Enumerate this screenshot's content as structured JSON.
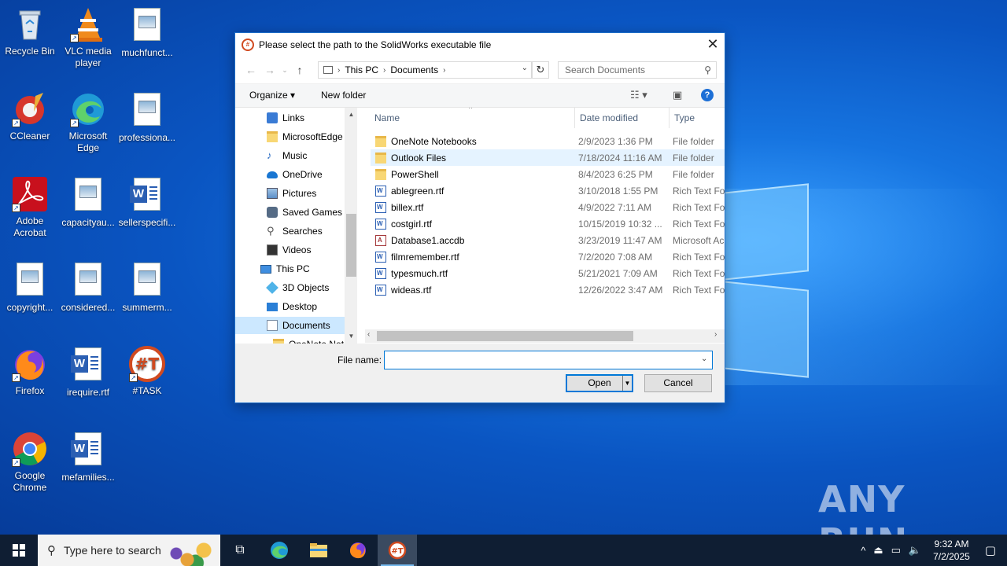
{
  "desktop": {
    "icons": [
      {
        "label": "Recycle Bin",
        "icon": "recycle-bin-icon"
      },
      {
        "label": "VLC media player",
        "icon": "vlc-icon"
      },
      {
        "label": "muchfunct...",
        "icon": "image-file-icon"
      },
      {
        "label": "CCleaner",
        "icon": "ccleaner-icon"
      },
      {
        "label": "Microsoft Edge",
        "icon": "edge-icon"
      },
      {
        "label": "professiona...",
        "icon": "image-file-icon"
      },
      {
        "label": "Adobe Acrobat",
        "icon": "acrobat-icon"
      },
      {
        "label": "capacityau...",
        "icon": "image-file-icon"
      },
      {
        "label": "sellerspecifi...",
        "icon": "word-doc-icon"
      },
      {
        "label": "copyright...",
        "icon": "image-file-icon"
      },
      {
        "label": "considered...",
        "icon": "image-file-icon"
      },
      {
        "label": "summerm...",
        "icon": "image-file-icon"
      },
      {
        "label": "Firefox",
        "icon": "firefox-icon"
      },
      {
        "label": "irequire.rtf",
        "icon": "word-doc-icon"
      },
      {
        "label": "#TASK",
        "icon": "task-app-icon"
      },
      {
        "label": "Google Chrome",
        "icon": "chrome-icon"
      },
      {
        "label": "mefamilies...",
        "icon": "word-doc-icon"
      }
    ],
    "watermark": "ANY RUN"
  },
  "dialog": {
    "title": "Please select the path to the SolidWorks executable file",
    "address": {
      "root": "This PC",
      "folder": "Documents"
    },
    "search_placeholder": "Search Documents",
    "toolbar": {
      "organize": "Organize",
      "new_folder": "New folder"
    },
    "nav_items": [
      {
        "label": "Links",
        "icon": "links-icon"
      },
      {
        "label": "MicrosoftEdge",
        "icon": "folder-icon"
      },
      {
        "label": "Music",
        "icon": "music-icon"
      },
      {
        "label": "OneDrive",
        "icon": "onedrive-icon"
      },
      {
        "label": "Pictures",
        "icon": "pictures-icon"
      },
      {
        "label": "Saved Games",
        "icon": "saved-games-icon"
      },
      {
        "label": "Searches",
        "icon": "searches-icon"
      },
      {
        "label": "Videos",
        "icon": "videos-icon"
      },
      {
        "label": "This PC",
        "icon": "this-pc-icon"
      },
      {
        "label": "3D Objects",
        "icon": "3d-objects-icon"
      },
      {
        "label": "Desktop",
        "icon": "desktop-icon"
      },
      {
        "label": "Documents",
        "icon": "documents-icon"
      },
      {
        "label": "OneNote Not",
        "icon": "folder-icon"
      }
    ],
    "columns": {
      "name": "Name",
      "date": "Date modified",
      "type": "Type"
    },
    "files": [
      {
        "name": "OneNote Notebooks",
        "date": "2/9/2023 1:36 PM",
        "type": "File folder",
        "kind": "folder"
      },
      {
        "name": "Outlook Files",
        "date": "7/18/2024 11:16 AM",
        "type": "File folder",
        "kind": "folder"
      },
      {
        "name": "PowerShell",
        "date": "8/4/2023 6:25 PM",
        "type": "File folder",
        "kind": "folder"
      },
      {
        "name": "ablegreen.rtf",
        "date": "3/10/2018 1:55 PM",
        "type": "Rich Text For",
        "kind": "rtf"
      },
      {
        "name": "billex.rtf",
        "date": "4/9/2022 7:11 AM",
        "type": "Rich Text For",
        "kind": "rtf"
      },
      {
        "name": "costgirl.rtf",
        "date": "10/15/2019 10:32 ...",
        "type": "Rich Text For",
        "kind": "rtf"
      },
      {
        "name": "Database1.accdb",
        "date": "3/23/2019 11:47 AM",
        "type": "Microsoft Ac",
        "kind": "accdb"
      },
      {
        "name": "filmremember.rtf",
        "date": "7/2/2020 7:08 AM",
        "type": "Rich Text For",
        "kind": "rtf"
      },
      {
        "name": "typesmuch.rtf",
        "date": "5/21/2021 7:09 AM",
        "type": "Rich Text For",
        "kind": "rtf"
      },
      {
        "name": "wideas.rtf",
        "date": "12/26/2022 3:47 AM",
        "type": "Rich Text For",
        "kind": "rtf"
      }
    ],
    "file_name_label": "File name:",
    "file_name_value": "",
    "open_label": "Open",
    "cancel_label": "Cancel"
  },
  "taskbar": {
    "search_placeholder": "Type here to search",
    "time": "9:32 AM",
    "date": "7/2/2025"
  }
}
